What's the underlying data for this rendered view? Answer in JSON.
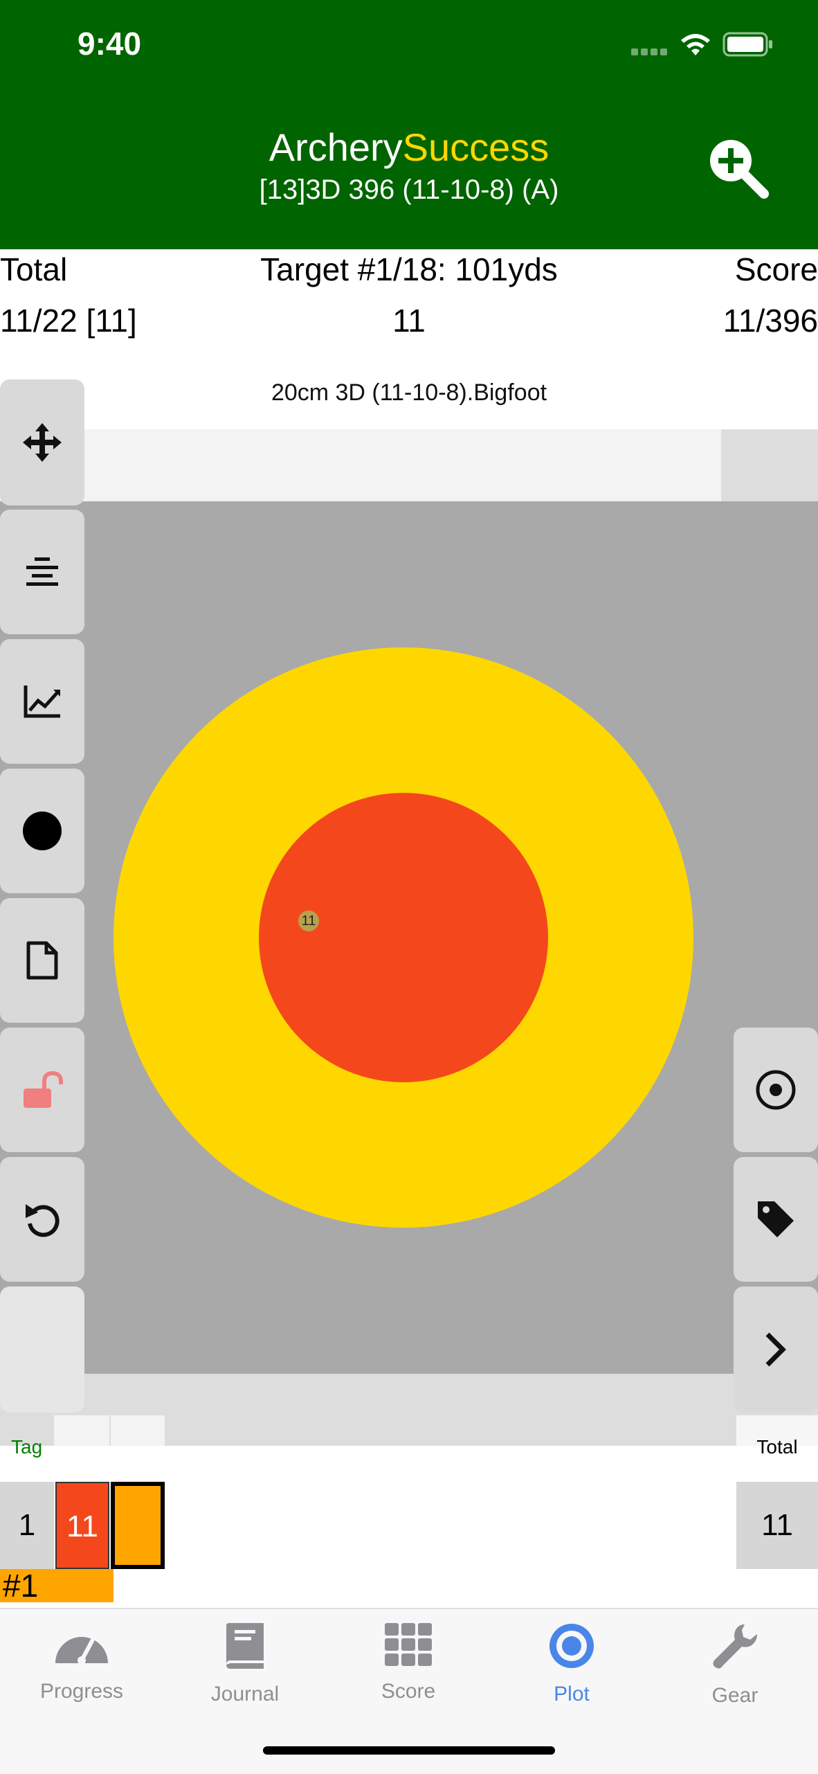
{
  "status_bar": {
    "time": "9:40"
  },
  "header": {
    "title_part1": "Archery",
    "title_part2": "Success",
    "subtitle": "[13]3D 396 (11-10-8) (A)",
    "colors": {
      "background": "#006400",
      "accent": "#ffd700"
    }
  },
  "info": {
    "total_label": "Total",
    "target_label": "Target #1/18: 101yds",
    "score_label": "Score",
    "total_value": "11/22 [11]",
    "target_value": "11",
    "score_value": "11/396",
    "face_name": "20cm 3D (11-10-8).Bigfoot"
  },
  "target": {
    "arrow_score": "11",
    "colors": {
      "outer": "#ffd700",
      "inner": "#f4481c",
      "background": "#a9a9a9"
    }
  },
  "left_toolbar": [
    "move-icon",
    "align-center-icon",
    "chart-icon",
    "dot-icon",
    "document-icon",
    "unlock-icon",
    "undo-icon",
    "blank"
  ],
  "right_toolbar": [
    "target-center-icon",
    "tag-icon",
    "chevron-right-icon"
  ],
  "score_table": {
    "tag_header": "Tag",
    "total_header": "Total",
    "end_number": "1",
    "arrow_score": "11",
    "end_total": "11",
    "end_tag": "#1"
  },
  "tabbar": {
    "tabs": [
      {
        "label": "Progress",
        "icon": "speedometer-icon"
      },
      {
        "label": "Journal",
        "icon": "book-icon"
      },
      {
        "label": "Score",
        "icon": "grid-icon"
      },
      {
        "label": "Plot",
        "icon": "target-icon",
        "active": true
      },
      {
        "label": "Gear",
        "icon": "wrench-icon"
      }
    ]
  }
}
